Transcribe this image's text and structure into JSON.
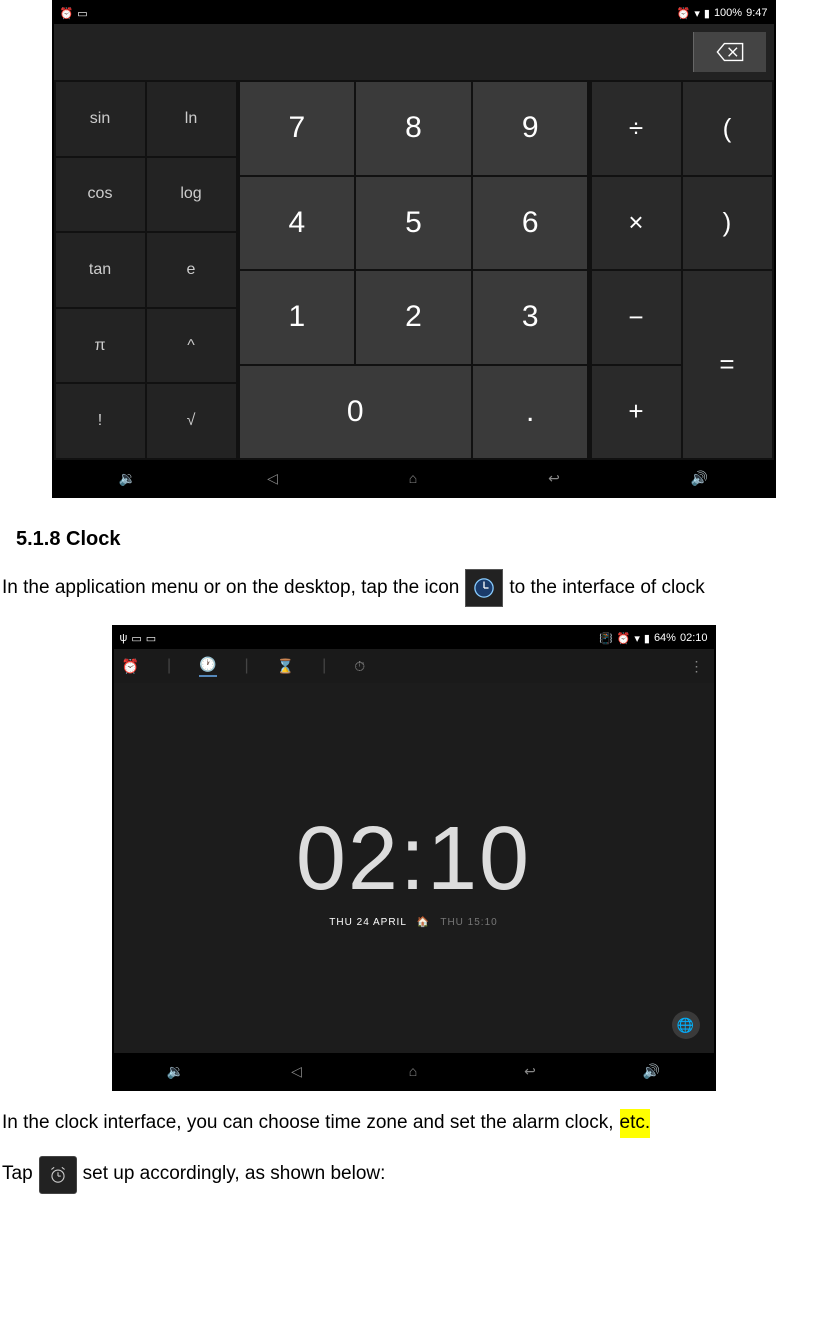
{
  "calculator": {
    "status": {
      "battery": "100%",
      "time": "9:47"
    },
    "functions": [
      "sin",
      "ln",
      "cos",
      "log",
      "tan",
      "e",
      "π",
      "^",
      "!",
      "√"
    ],
    "numbers": [
      "7",
      "8",
      "9",
      "4",
      "5",
      "6",
      "1",
      "2",
      "3",
      "0",
      "."
    ],
    "operators": {
      "div": "÷",
      "lparen": "(",
      "mul": "×",
      "rparen": ")",
      "sub": "−",
      "add": "+",
      "eq": "="
    }
  },
  "section": {
    "heading": "5.1.8 Clock"
  },
  "text": {
    "para1a": "In the application menu or on the desktop, tap the icon",
    "para1b": "to the interface of clock",
    "para2": "In the clock interface, you can choose time zone and set the alarm clock, ",
    "para2_hl": "etc.",
    "para3a": "Tap",
    "para3b": "set up accordingly, as shown below:"
  },
  "clock": {
    "status": {
      "battery": "64%",
      "time": "02:10"
    },
    "bigtime": "02:10",
    "date": "THU 24 APRIL",
    "secondary_label": "THU 15:10"
  }
}
